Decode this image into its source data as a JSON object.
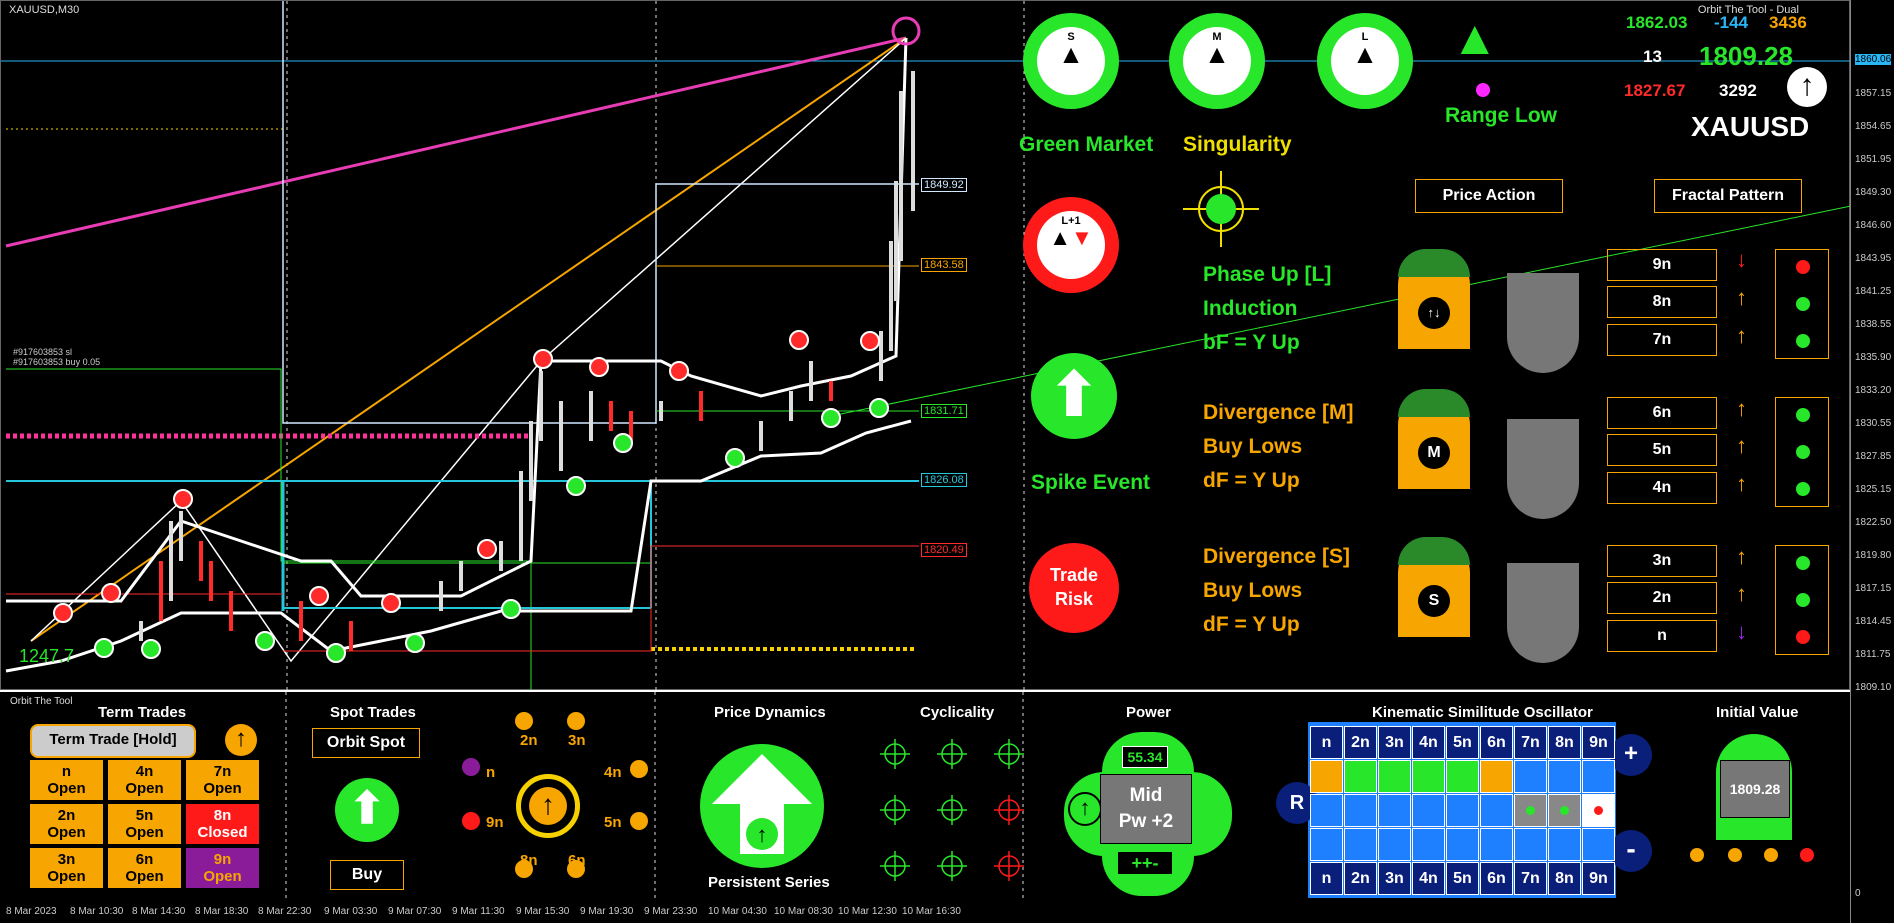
{
  "window": {
    "symbol_label": "XAUUSD,M30",
    "indicator_title": "Orbit The Tool - Dual"
  },
  "price_axis": [
    "1860.06",
    "1857.15",
    "1854.65",
    "1851.95",
    "1849.30",
    "1846.60",
    "1843.95",
    "1841.25",
    "1838.55",
    "1835.90",
    "1833.20",
    "1830.55",
    "1827.85",
    "1825.15",
    "1822.50",
    "1819.80",
    "1817.15",
    "1814.45",
    "1811.75",
    "1809.10",
    "0"
  ],
  "time_axis": [
    "8 Mar 2023",
    "8 Mar 10:30",
    "8 Mar 14:30",
    "8 Mar 18:30",
    "8 Mar 22:30",
    "9 Mar 03:30",
    "9 Mar 07:30",
    "9 Mar 11:30",
    "9 Mar 15:30",
    "9 Mar 19:30",
    "9 Mar 23:30",
    "10 Mar 04:30",
    "10 Mar 08:30",
    "10 Mar 12:30",
    "10 Mar 16:30"
  ],
  "price_levels": {
    "l1": "1849.92",
    "l2": "1843.58",
    "l3": "1831.71",
    "l4": "1826.08",
    "l5": "1820.49"
  },
  "chart_labels": {
    "order_sl": "#917603853 sl",
    "order_buy": "#917603853 buy 0.05",
    "left_value": "1247.7"
  },
  "header_stats": {
    "high": "1862.03",
    "delta": "-144",
    "range": "3436",
    "count": "13",
    "price": "1809.28",
    "low": "1827.67",
    "pips": "3292",
    "symbol": "XAUUSD"
  },
  "gauges": {
    "s": "S",
    "m": "M",
    "l": "L",
    "l1": "L+1"
  },
  "labels": {
    "green_market": "Green Market",
    "singularity": "Singularity",
    "range_low": "Range Low",
    "spike_event": "Spike Event",
    "trade_risk_1": "Trade",
    "trade_risk_2": "Risk"
  },
  "buttons": {
    "price_action": "Price Action",
    "fractal_pattern": "Fractal Pattern"
  },
  "phases": {
    "l": {
      "line1": "Phase Up [L]",
      "line2": "Induction",
      "line3": "bF = Y Up"
    },
    "m": {
      "line1": "Divergence [M]",
      "line2": "Buy Lows",
      "line3": "dF = Y Up",
      "badge": "M"
    },
    "s": {
      "line1": "Divergence [S]",
      "line2": "Buy Lows",
      "line3": "dF = Y Up",
      "badge": "S"
    }
  },
  "n_levels": [
    "9n",
    "8n",
    "7n",
    "6n",
    "5n",
    "4n",
    "3n",
    "2n",
    "n"
  ],
  "bottom": {
    "orbit_the_tool": "Orbit The Tool",
    "term_trades": "Term Trades",
    "term_trade_hold": "Term Trade [Hold]",
    "term_cells": [
      {
        "n": "n",
        "s": "Open"
      },
      {
        "n": "4n",
        "s": "Open"
      },
      {
        "n": "7n",
        "s": "Open"
      },
      {
        "n": "2n",
        "s": "Open"
      },
      {
        "n": "5n",
        "s": "Open"
      },
      {
        "n": "8n",
        "s": "Closed"
      },
      {
        "n": "3n",
        "s": "Open"
      },
      {
        "n": "6n",
        "s": "Open"
      },
      {
        "n": "9n",
        "s": "Open"
      }
    ],
    "spot_trades": "Spot Trades",
    "orbit_spot": "Orbit Spot",
    "buy": "Buy",
    "orbit_ring": [
      "2n",
      "3n",
      "4n",
      "5n",
      "6n",
      "8n",
      "9n",
      "n"
    ],
    "price_dynamics": "Price Dynamics",
    "persistent_series": "Persistent Series",
    "cyclicality": "Cyclicality",
    "power": "Power",
    "power_value": "55.34",
    "power_mid": "Mid",
    "power_pw": "Pw +2",
    "power_sign": "++-",
    "kso_title": "Kinematic Similitude Oscillator",
    "kso_headers": [
      "n",
      "2n",
      "3n",
      "4n",
      "5n",
      "6n",
      "7n",
      "8n",
      "9n"
    ],
    "kso_plus": "+",
    "kso_minus": "-",
    "kso_r": "R",
    "initial_value": "Initial Value",
    "initial_price": "1809.28"
  },
  "colors": {
    "green": "#28e62a",
    "orange": "#f7a500",
    "red": "#ff1a1a",
    "blue": "#1e7fff",
    "cyan": "#26c6da",
    "magenta": "#e83cb4"
  }
}
